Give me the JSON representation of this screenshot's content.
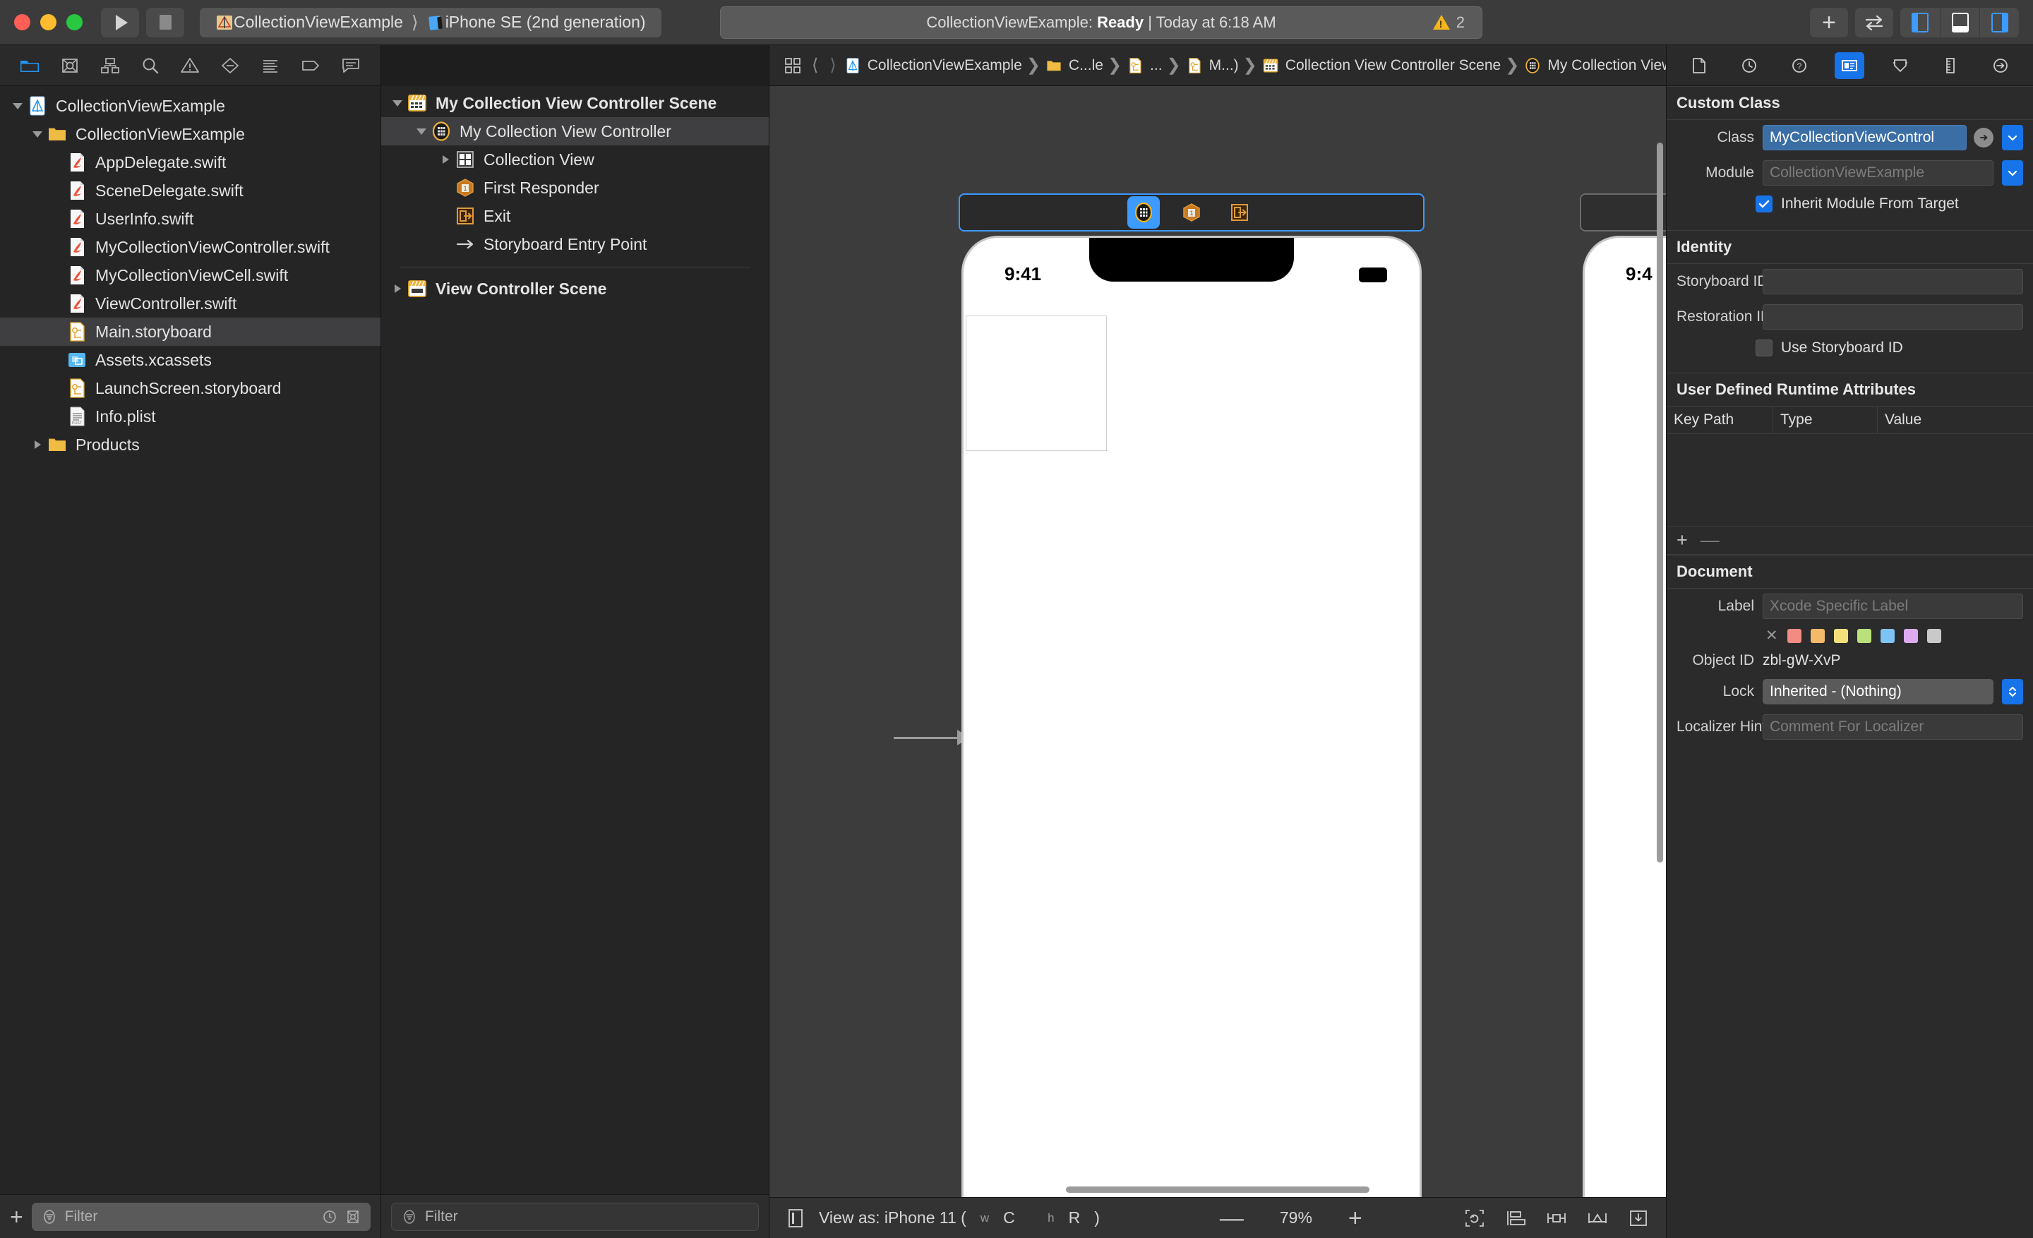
{
  "toolbar": {
    "run_button": "run-button",
    "stop_button": "stop-button",
    "scheme_project": "CollectionViewExample",
    "scheme_destination": "iPhone SE (2nd generation)",
    "status_project": "CollectionViewExample:",
    "status_state": "Ready",
    "status_time": "| Today at 6:18 AM",
    "warning_count": "2"
  },
  "navigator": {
    "tabs": [
      "folder-icon",
      "source-control-icon",
      "hierarchy-icon",
      "search-icon",
      "warning-triangle-icon",
      "breakpoint-icon",
      "report-icon",
      "tag-icon",
      "comment-icon"
    ],
    "items": [
      {
        "label": "CollectionViewExample",
        "indent": 0,
        "icon": "xcode-project-icon",
        "arrow": "open"
      },
      {
        "label": "CollectionViewExample",
        "indent": 1,
        "icon": "folder-yellow-icon",
        "arrow": "open"
      },
      {
        "label": "AppDelegate.swift",
        "indent": 2,
        "icon": "swift-file-icon",
        "arrow": "none"
      },
      {
        "label": "SceneDelegate.swift",
        "indent": 2,
        "icon": "swift-file-icon",
        "arrow": "none"
      },
      {
        "label": "UserInfo.swift",
        "indent": 2,
        "icon": "swift-file-icon",
        "arrow": "none"
      },
      {
        "label": "MyCollectionViewController.swift",
        "indent": 2,
        "icon": "swift-file-icon",
        "arrow": "none"
      },
      {
        "label": "MyCollectionViewCell.swift",
        "indent": 2,
        "icon": "swift-file-icon",
        "arrow": "none"
      },
      {
        "label": "ViewController.swift",
        "indent": 2,
        "icon": "swift-file-icon",
        "arrow": "none"
      },
      {
        "label": "Main.storyboard",
        "indent": 2,
        "icon": "storyboard-file-icon",
        "arrow": "none",
        "selected": true
      },
      {
        "label": "Assets.xcassets",
        "indent": 2,
        "icon": "assets-catalog-icon",
        "arrow": "none"
      },
      {
        "label": "LaunchScreen.storyboard",
        "indent": 2,
        "icon": "storyboard-file-icon",
        "arrow": "none"
      },
      {
        "label": "Info.plist",
        "indent": 2,
        "icon": "plist-file-icon",
        "arrow": "none"
      },
      {
        "label": "Products",
        "indent": 1,
        "icon": "folder-yellow-icon",
        "arrow": "closed"
      }
    ],
    "filter_placeholder": "Filter"
  },
  "outline": {
    "items": [
      {
        "label": "My Collection View Controller Scene",
        "indent": 0,
        "icon": "scene-icon",
        "arrow": "open",
        "bold": true
      },
      {
        "label": "My Collection View Controller",
        "indent": 1,
        "icon": "collection-view-controller-icon",
        "arrow": "open",
        "selected": true
      },
      {
        "label": "Collection View",
        "indent": 2,
        "icon": "collection-view-icon",
        "arrow": "closed"
      },
      {
        "label": "First Responder",
        "indent": 2,
        "icon": "first-responder-icon",
        "arrow": "none"
      },
      {
        "label": "Exit",
        "indent": 2,
        "icon": "exit-icon",
        "arrow": "none"
      },
      {
        "label": "Storyboard Entry Point",
        "indent": 2,
        "icon": "entry-point-arrow-icon",
        "arrow": "none"
      }
    ],
    "second_scene": {
      "label": "View Controller Scene",
      "icon": "scene-icon",
      "arrow": "closed",
      "bold": true
    },
    "filter_placeholder": "Filter"
  },
  "jumpbar": {
    "crumbs": [
      {
        "label": "CollectionViewExample",
        "icon": "xcode-project-icon"
      },
      {
        "label": "C...le",
        "icon": "folder-yellow-icon"
      },
      {
        "label": "...",
        "icon": "storyboard-file-icon"
      },
      {
        "label": "M...)",
        "icon": "storyboard-file-icon"
      },
      {
        "label": "Collection View Controller Scene",
        "icon": "scene-icon"
      },
      {
        "label": "My Collection View Controller",
        "icon": "collection-view-controller-icon"
      }
    ]
  },
  "canvas": {
    "segmented_items": [
      "collection-view-controller-icon",
      "first-responder-icon",
      "exit-icon"
    ],
    "device_time": "9:41",
    "device_time_secondary": "9:4"
  },
  "canvas_bar": {
    "view_as_label": "View as: iPhone 11 (",
    "size_class_w": "w",
    "size_class_wc": "C",
    "size_class_h": "h",
    "size_class_hr": "R",
    "view_as_close": ")",
    "zoom_out": "—",
    "zoom_value": "79%",
    "zoom_in": "+",
    "right_icons": [
      "update-frames-icon",
      "align-icon",
      "pin-icon",
      "add-constraints-icon",
      "resolve-issues-icon"
    ]
  },
  "inspector": {
    "tabs": [
      "file-inspector-icon",
      "history-inspector-icon",
      "quick-help-icon",
      "identity-inspector-icon",
      "attributes-inspector-icon",
      "size-inspector-icon",
      "connections-inspector-icon"
    ],
    "custom_class": {
      "title": "Custom Class",
      "class_label": "Class",
      "class_value": "MyCollectionViewControl",
      "module_label": "Module",
      "module_value": "CollectionViewExample",
      "inherit_label": "Inherit Module From Target",
      "inherit_checked": true
    },
    "identity": {
      "title": "Identity",
      "storyboard_id_label": "Storyboard ID",
      "storyboard_id_value": "",
      "restoration_id_label": "Restoration ID",
      "restoration_id_value": "",
      "use_storyboard_id_label": "Use Storyboard ID",
      "use_storyboard_id_checked": false
    },
    "udra": {
      "title": "User Defined Runtime Attributes",
      "col_key": "Key Path",
      "col_type": "Type",
      "col_value": "Value",
      "add_label": "+",
      "remove_label": "—"
    },
    "document": {
      "title": "Document",
      "label_label": "Label",
      "label_placeholder": "Xcode Specific Label",
      "swatch_clear": "✕",
      "swatches": [
        "#f28b82",
        "#f5b96a",
        "#f3e07a",
        "#b9e07a",
        "#7ec3f5",
        "#dda9ef",
        "#c9c9c9"
      ],
      "object_id_label": "Object ID",
      "object_id_value": "zbl-gW-XvP",
      "lock_label": "Lock",
      "lock_value": "Inherited - (Nothing)",
      "localizer_label": "Localizer Hint",
      "localizer_placeholder": "Comment For Localizer"
    }
  },
  "colors": {
    "accent_blue": "#1773e8",
    "warning_yellow": "#f5b51a",
    "selection_blue": "#3a6ea5"
  }
}
